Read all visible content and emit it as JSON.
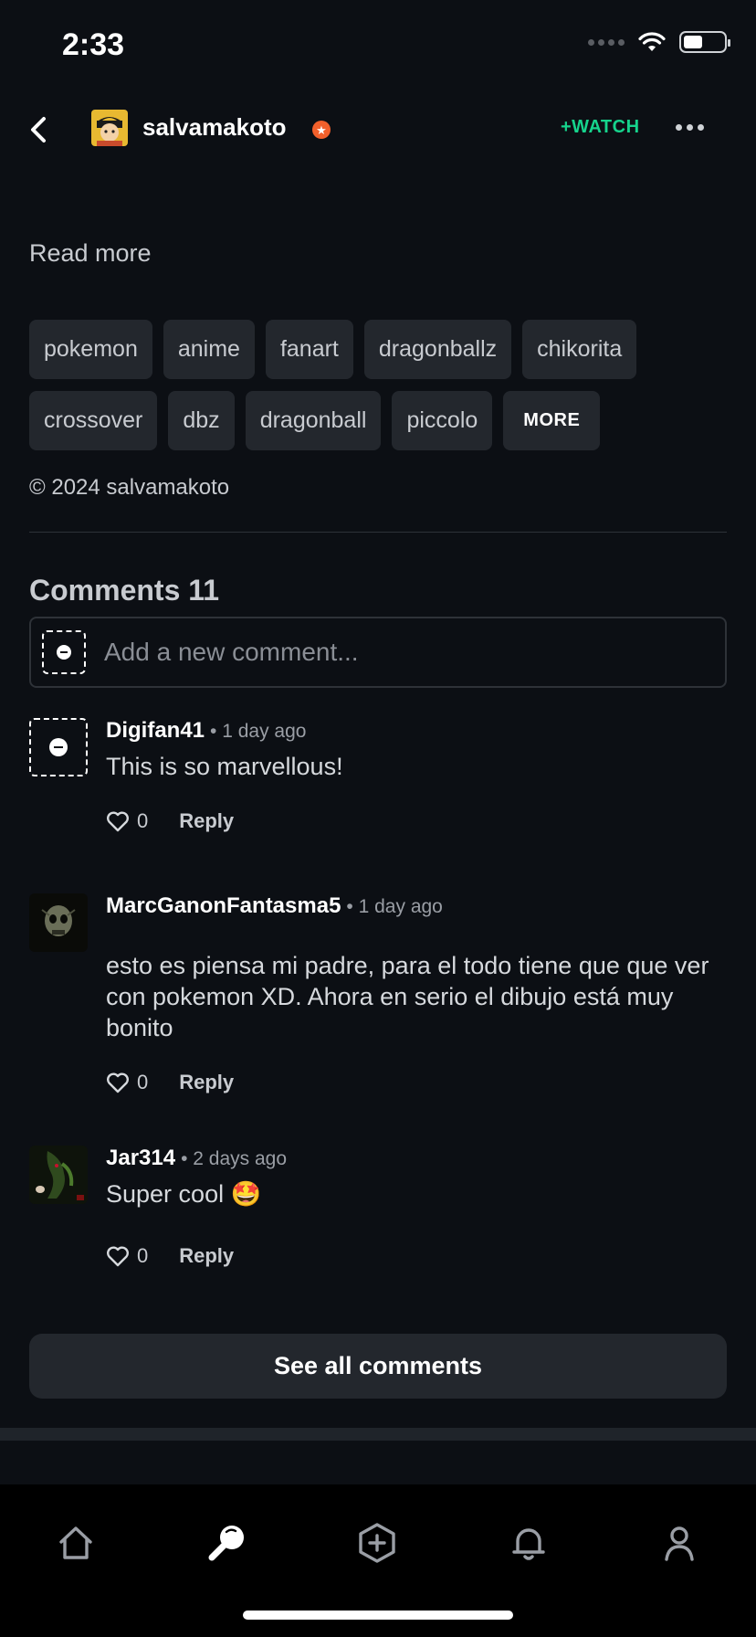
{
  "status_bar": {
    "time": "2:33"
  },
  "header": {
    "username": "salvamakoto",
    "watch_label": "+WATCH"
  },
  "description": {
    "read_more": "Read more"
  },
  "tags": {
    "row1": [
      "pokemon",
      "anime",
      "fanart",
      "dragonballz",
      "chikorita"
    ],
    "row2": [
      "crossover",
      "dbz",
      "dragonball",
      "piccolo"
    ],
    "more_label": "MORE"
  },
  "copyright": "© 2024 salvamakoto",
  "comments": {
    "title": "Comments 11",
    "input_placeholder": "Add a new comment...",
    "items": [
      {
        "user": "Digifan41",
        "time": "• 1 day ago",
        "text": "This is so marvellous!",
        "likes": "0",
        "reply": "Reply"
      },
      {
        "user": "MarcGanonFantasma5",
        "time": "• 1 day ago",
        "text": "esto es piensa mi padre, para el todo tiene que que ver con pokemon XD. Ahora en serio el dibujo está muy bonito",
        "likes": "0",
        "reply": "Reply"
      },
      {
        "user": "Jar314",
        "time": "• 2 days ago",
        "text": "Super cool 🤩",
        "likes": "0",
        "reply": "Reply"
      }
    ],
    "see_all": "See all comments"
  },
  "tabbar": {
    "items": [
      "home-icon",
      "search-icon",
      "create-icon",
      "notifications-icon",
      "profile-icon"
    ],
    "active": "search-icon"
  },
  "colors": {
    "background": "#0c0f14",
    "accent_watch": "#16d38c",
    "badge": "#f2602b",
    "chip": "#23272d"
  }
}
